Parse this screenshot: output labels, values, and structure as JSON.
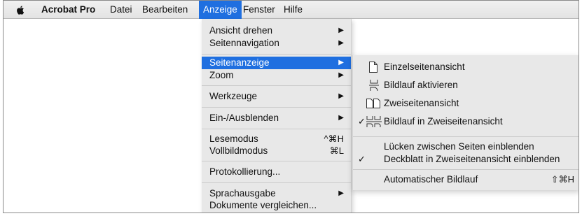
{
  "menubar": {
    "app_name": "Acrobat Pro",
    "items": [
      "Datei",
      "Bearbeiten",
      "Anzeige",
      "Fenster",
      "Hilfe"
    ]
  },
  "menu": {
    "items": [
      {
        "label": "Ansicht drehen",
        "submenu": true
      },
      {
        "label": "Seitennavigation",
        "submenu": true
      },
      {
        "label": "Seitenanzeige",
        "submenu": true,
        "highlighted": true
      },
      {
        "label": "Zoom",
        "submenu": true
      },
      {
        "label": "Werkzeuge",
        "submenu": true
      },
      {
        "label": "Ein-/Ausblenden",
        "submenu": true
      },
      {
        "label": "Lesemodus",
        "shortcut": "^⌘H"
      },
      {
        "label": "Vollbildmodus",
        "shortcut": "⌘L"
      },
      {
        "label": "Protokollierung..."
      },
      {
        "label": "Sprachausgabe",
        "submenu": true
      },
      {
        "label": "Dokumente vergleichen..."
      }
    ]
  },
  "submenu": {
    "items": [
      {
        "label": "Einzelseitenansicht",
        "icon": "single-page-icon"
      },
      {
        "label": "Bildlauf aktivieren",
        "icon": "scroll-page-icon"
      },
      {
        "label": "Zweiseitenansicht",
        "icon": "two-page-icon"
      },
      {
        "label": "Bildlauf in Zweiseitenansicht",
        "icon": "two-page-scroll-icon",
        "checked": true
      },
      {
        "label": "Lücken zwischen Seiten einblenden"
      },
      {
        "label": "Deckblatt in Zweiseitenansicht einblenden",
        "checked": true
      },
      {
        "label": "Automatischer Bildlauf",
        "shortcut": "⇧⌘H"
      }
    ],
    "check_mark": "✓"
  },
  "colors": {
    "highlight": "#1f6fe0",
    "menu_bg": "#e8e8e8",
    "menubar_bg": "#ececec"
  }
}
